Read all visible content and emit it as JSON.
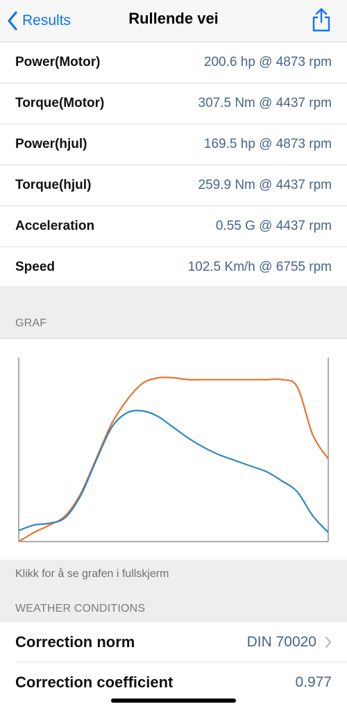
{
  "nav": {
    "back_label": "Results",
    "title": "Rullende vei",
    "share_icon": "share-icon"
  },
  "results": [
    {
      "label": "Power(Motor)",
      "value": "200.6 hp @ 4873 rpm"
    },
    {
      "label": "Torque(Motor)",
      "value": "307.5 Nm @ 4437 rpm"
    },
    {
      "label": "Power(hjul)",
      "value": "169.5 hp @ 4873 rpm"
    },
    {
      "label": "Torque(hjul)",
      "value": "259.9 Nm @ 4437 rpm"
    },
    {
      "label": "Acceleration",
      "value": "0.55 G @ 4437 rpm"
    },
    {
      "label": "Speed",
      "value": "102.5 Km/h @ 6755 rpm"
    }
  ],
  "graph_section": {
    "header": "GRAF",
    "hint": "Klikk for å se grafen i fullskjerm"
  },
  "weather": {
    "header": "WEATHER CONDITIONS",
    "rows": [
      {
        "label": "Correction norm",
        "value": "DIN 70020"
      },
      {
        "label": "Correction coefficient",
        "value": "0.977"
      }
    ]
  },
  "colors": {
    "accent": "#0a74ff",
    "value_text": "#48638a",
    "power_curve": "#e8732a",
    "torque_curve": "#2d87c0"
  },
  "chart_data": {
    "type": "line",
    "x": [
      0,
      5,
      10,
      15,
      20,
      25,
      30,
      35,
      40,
      45,
      50,
      55,
      60,
      65,
      70,
      75,
      80,
      85,
      90,
      95,
      100
    ],
    "series": [
      {
        "values": [
          0,
          5,
          9,
          14,
          26,
          45,
          64,
          77,
          86,
          89,
          89,
          88,
          88,
          88,
          88,
          88,
          88,
          88,
          84,
          58,
          45
        ]
      },
      {
        "values": [
          6,
          9,
          10,
          13,
          25,
          44,
          62,
          70,
          71,
          68,
          62,
          56,
          51,
          47,
          44,
          41,
          38,
          33,
          27,
          14,
          5
        ]
      }
    ],
    "xlim": [
      0,
      100
    ],
    "ylim": [
      0,
      100
    ],
    "grid": false
  }
}
